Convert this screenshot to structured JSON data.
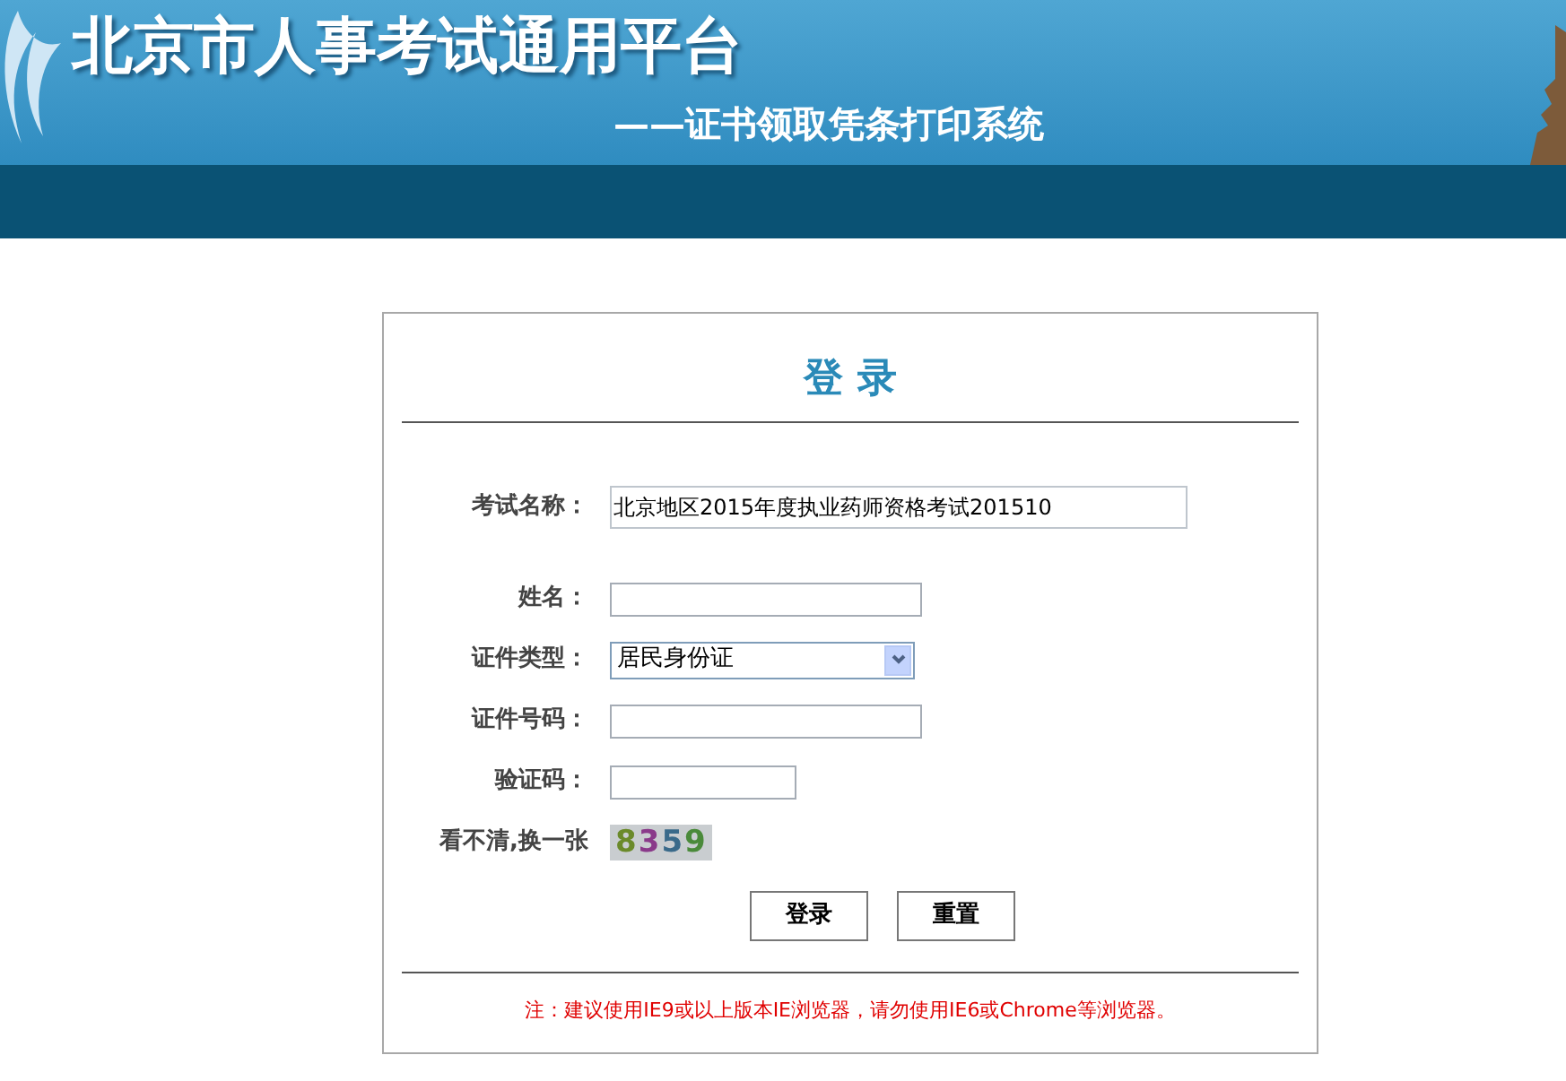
{
  "header": {
    "title": "北京市人事考试通用平台",
    "subtitle": "——证书领取凭条打印系统"
  },
  "login": {
    "title": "登 录",
    "exam": {
      "label": "考试名称：",
      "value": "北京地区2015年度执业药师资格考试201510"
    },
    "fields": [
      {
        "kind": "input",
        "label": "姓名："
      },
      {
        "kind": "select",
        "label": "证件类型：",
        "value": "居民身份证"
      },
      {
        "kind": "input",
        "label": "证件号码："
      },
      {
        "kind": "code",
        "label": "验证码："
      }
    ],
    "captcha": {
      "label": "看不清,换一张",
      "code": "8359"
    },
    "buttons": [
      "登录",
      "重置"
    ],
    "note": "注：建议使用IE9或以上版本IE浏览器，请勿使用IE6或Chrome等浏览器。"
  }
}
